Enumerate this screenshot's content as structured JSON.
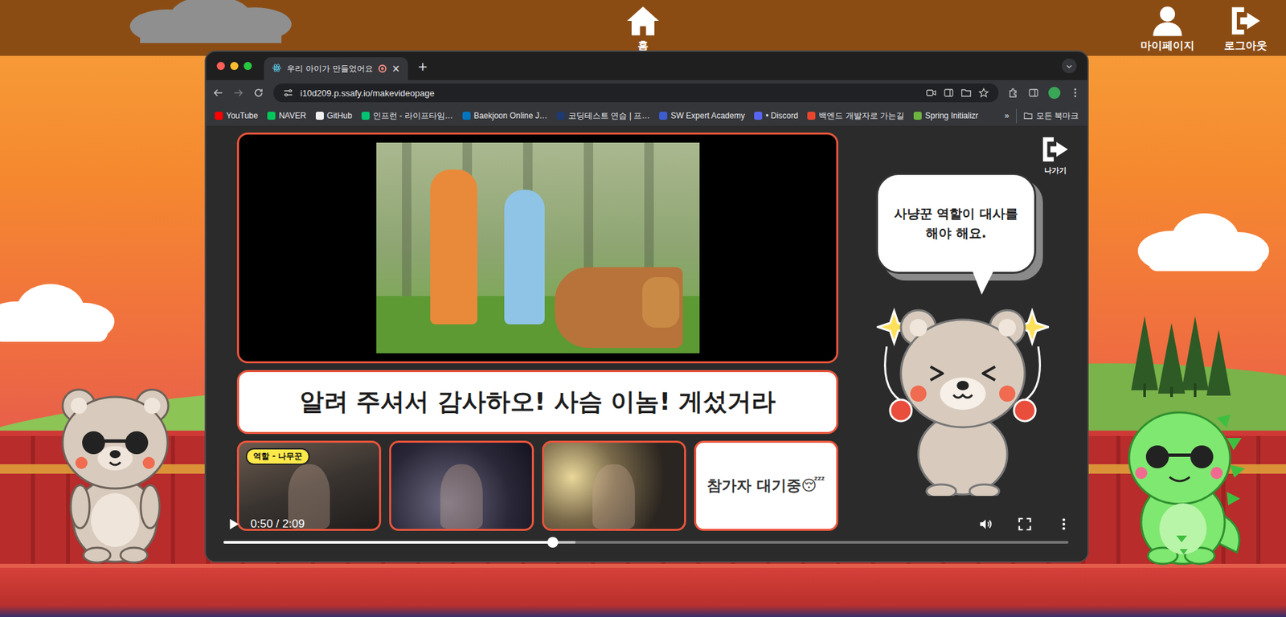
{
  "nav": {
    "home": "홈",
    "mypage": "마이페이지",
    "logout": "로그아웃"
  },
  "browser": {
    "tab": {
      "title": "우리 아이가 만들었어요",
      "close": "×",
      "recording": true
    },
    "new_tab": "+",
    "url": "i10d209.p.ssafy.io/makevideopage",
    "bookmarks": [
      {
        "label": "YouTube",
        "color": "#ff0000"
      },
      {
        "label": "NAVER",
        "color": "#03c75a"
      },
      {
        "label": "GitHub",
        "color": "#f0f0f0"
      },
      {
        "label": "인프런 - 라이프타임…",
        "color": "#00c471"
      },
      {
        "label": "Baekjoon Online J…",
        "color": "#0076c0"
      },
      {
        "label": "코딩테스트 연습 | 프…",
        "color": "#1e3a70"
      },
      {
        "label": "SW Expert Academy",
        "color": "#3c5ccf"
      },
      {
        "label": "• Discord",
        "color": "#5865f2"
      },
      {
        "label": "백엔드 개발자로 가는길",
        "color": "#e8452c"
      },
      {
        "label": "Spring Initializr",
        "color": "#6db33f"
      }
    ],
    "more_bookmarks": "»",
    "all_bookmarks": "모든 북마크"
  },
  "page": {
    "exit": "나가기",
    "subtitle": "알려 주셔서 감사하오! 사슴 이놈! 게섰거라",
    "bubble": "사냥꾼 역할이 대사를 해야 해요.",
    "participants": [
      {
        "kind": "video",
        "badge": "역할 - 나무꾼"
      },
      {
        "kind": "video"
      },
      {
        "kind": "video"
      },
      {
        "kind": "waiting",
        "text": "참가자 대기중😴"
      }
    ]
  },
  "player": {
    "time": "0:50 / 2:09",
    "playing": false,
    "level": 0.39,
    "buffered": 0.417
  }
}
